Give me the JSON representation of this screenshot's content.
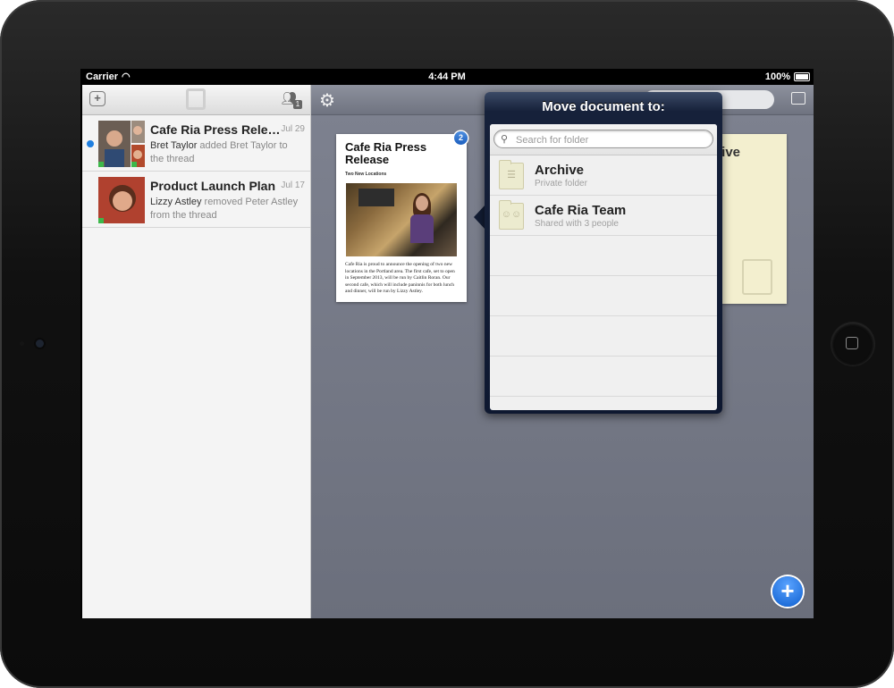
{
  "status_bar": {
    "carrier": "Carrier",
    "time": "4:44 PM",
    "battery": "100%"
  },
  "left_panel": {
    "people_badge": "1",
    "threads": [
      {
        "title": "Cafe Ria Press Release",
        "date": "Jul 29",
        "actor": "Bret Taylor",
        "action": " added Bret Taylor to the thread",
        "unread": true
      },
      {
        "title": "Product Launch Plan",
        "date": "Jul 17",
        "actor": "Lizzy Astley",
        "action": " removed Peter Astley from the thread",
        "unread": false
      }
    ]
  },
  "main": {
    "document": {
      "title": "Cafe Ria Press Release",
      "subtitle": "Two New Locations",
      "body": "Cafe Ria is proud to announce the opening of two new locations in the Portland area. The first cafe, set to open in September 2013, will be run by Caitlin Roran. Our second cafe, which will include paninnis for both lunch and dinner, will be run by Lizzy Astley.",
      "badge": "2"
    },
    "sticky_text": "hive",
    "add_button": "+"
  },
  "popover": {
    "title": "Move document to:",
    "search_placeholder": "Search for folder",
    "folders": [
      {
        "name": "Archive",
        "subtitle": "Private folder",
        "icon": "cabinet-icon"
      },
      {
        "name": "Cafe Ria Team",
        "subtitle": "Shared with 3 people",
        "icon": "people-icon"
      }
    ]
  },
  "colors": {
    "accent": "#1f7fe0",
    "popover_header": "#16213a",
    "main_bg": "#767a87"
  }
}
